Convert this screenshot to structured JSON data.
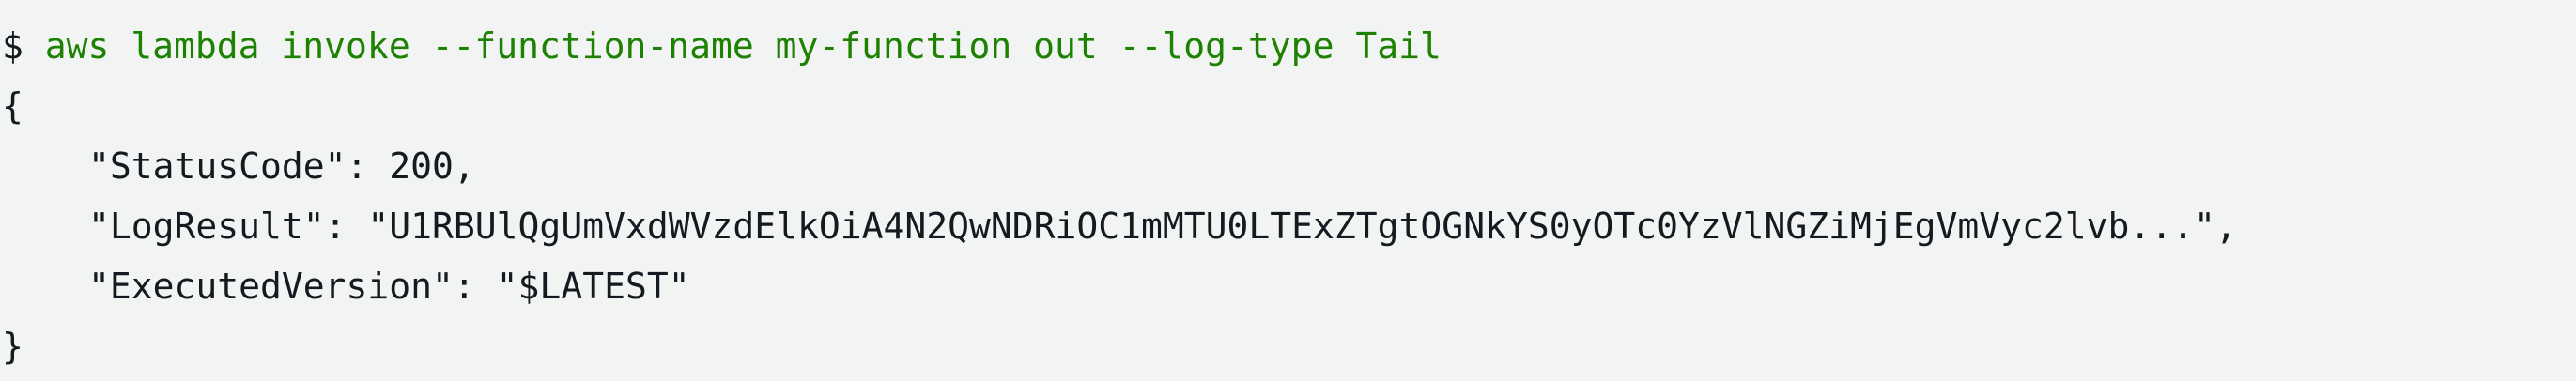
{
  "terminal": {
    "prompt": "$ ",
    "command": "aws lambda invoke --function-name my-function out --log-type Tail",
    "output": {
      "open_brace": "{",
      "lines": [
        "\"StatusCode\": 200,",
        "\"LogResult\": \"U1RBUlQgUmVxdWVzdElkOiA4N2QwNDRiOC1mMTU0LTExZTgtOGNkYS0yOTc0YzVlNGZiMjEgVmVyc2lvb...\",",
        "\"ExecutedVersion\": \"$LATEST\""
      ],
      "close_brace": "}"
    }
  },
  "colors": {
    "background": "#f2f3f3",
    "text": "#16191f",
    "command": "#1d8102"
  }
}
